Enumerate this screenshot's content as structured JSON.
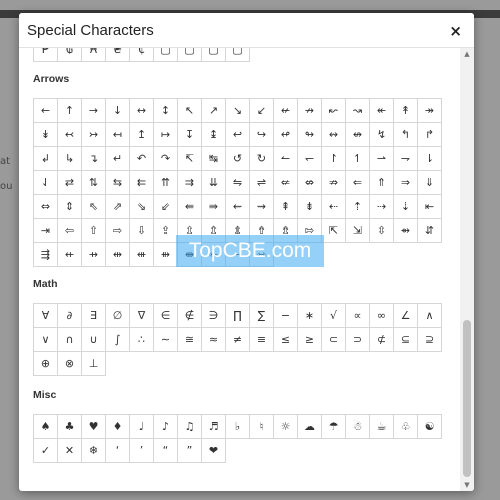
{
  "dialog": {
    "title": "Special Characters",
    "close": "×"
  },
  "background": {
    "chars_top": "at",
    "chars_mid": "ou"
  },
  "scrollbar": {
    "up": "▲",
    "down": "▼"
  },
  "watermark": "TopCBE.com",
  "sections": [
    {
      "title": "",
      "chars": [
        "₱",
        "₲",
        "₳",
        "₴",
        "₵",
        "▢",
        "▢",
        "▢",
        "▢"
      ]
    },
    {
      "title": "Arrows",
      "chars": [
        "←",
        "↑",
        "→",
        "↓",
        "↔",
        "↕",
        "↖",
        "↗",
        "↘",
        "↙",
        "↚",
        "↛",
        "↜",
        "↝",
        "↞",
        "↟",
        "↠",
        "↡",
        "↢",
        "↣",
        "↤",
        "↥",
        "↦",
        "↧",
        "↨",
        "↩",
        "↪",
        "↫",
        "↬",
        "↭",
        "↮",
        "↯",
        "↰",
        "↱",
        "↲",
        "↳",
        "↴",
        "↵",
        "↶",
        "↷",
        "↸",
        "↹",
        "↺",
        "↻",
        "↼",
        "↽",
        "↾",
        "↿",
        "⇀",
        "⇁",
        "⇂",
        "⇃",
        "⇄",
        "⇅",
        "⇆",
        "⇇",
        "⇈",
        "⇉",
        "⇊",
        "⇋",
        "⇌",
        "⇍",
        "⇎",
        "⇏",
        "⇐",
        "⇑",
        "⇒",
        "⇓",
        "⇔",
        "⇕",
        "⇖",
        "⇗",
        "⇘",
        "⇙",
        "⇚",
        "⇛",
        "⇜",
        "⇝",
        "⇞",
        "⇟",
        "⇠",
        "⇡",
        "⇢",
        "⇣",
        "⇤",
        "⇥",
        "⇦",
        "⇧",
        "⇨",
        "⇩",
        "⇪",
        "⇫",
        "⇬",
        "⇭",
        "⇮",
        "⇯",
        "⇰",
        "⇱",
        "⇲",
        "⇳",
        "⇴",
        "⇵",
        "⇶",
        "⇷",
        "⇸",
        "⇹",
        "⇺",
        "⇻",
        "⇼",
        "⇽",
        "⇾",
        "⇿"
      ]
    },
    {
      "title": "Math",
      "chars": [
        "∀",
        "∂",
        "∃",
        "∅",
        "∇",
        "∈",
        "∉",
        "∋",
        "∏",
        "∑",
        "−",
        "∗",
        "√",
        "∝",
        "∞",
        "∠",
        "∧",
        "∨",
        "∩",
        "∪",
        "∫",
        "∴",
        "∼",
        "≅",
        "≈",
        "≠",
        "≡",
        "≤",
        "≥",
        "⊂",
        "⊃",
        "⊄",
        "⊆",
        "⊇",
        "⊕",
        "⊗",
        "⊥"
      ]
    },
    {
      "title": "Misc",
      "chars": [
        "♠",
        "♣",
        "♥",
        "♦",
        "♩",
        "♪",
        "♫",
        "♬",
        "♭",
        "♮",
        "☼",
        "☁",
        "☂",
        "☃",
        "☕",
        "♧",
        "☯",
        "✓",
        "✕",
        "❄",
        "‘",
        "’",
        "“",
        "”",
        "❤"
      ]
    }
  ]
}
